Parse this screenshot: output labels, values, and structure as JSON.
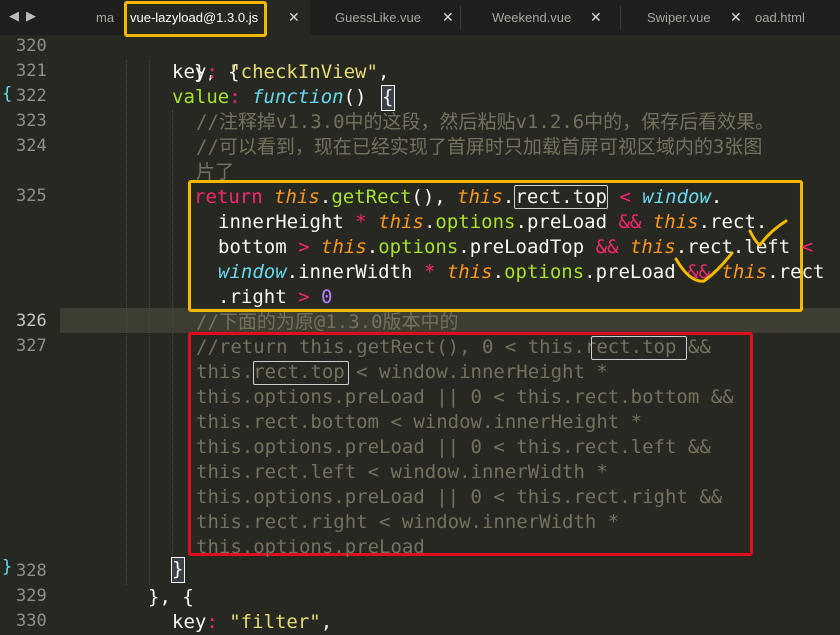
{
  "tabs": [
    {
      "label": "ma"
    },
    {
      "label": "vue-lazyload@1.3.0.js"
    },
    {
      "label": "GuessLike.vue"
    },
    {
      "label": "Weekend.vue"
    },
    {
      "label": "Swiper.vue"
    },
    {
      "label": "oad.html"
    }
  ],
  "nav": {
    "back": "◀",
    "forward": "▶"
  },
  "close_glyph": "✕",
  "line_numbers": [
    "320",
    "321",
    "322",
    "323",
    "324",
    "325",
    "326",
    "327",
    "328",
    "329",
    "330"
  ],
  "code": {
    "l320": "}, {",
    "l321_key": "key",
    "l321_colon": ": ",
    "l321_val": "\"checkInView\"",
    "l321_comma": ",",
    "l322_value": "value",
    "l322_colon": ": ",
    "l322_function": "function",
    "l322_paren": "() ",
    "l322_brace": "{",
    "l323": "//注释掉v1.3.0中的这段，然后粘贴v1.2.6中的，保存后看效果。",
    "l324a": "//可以看到，现在已经实现了首屏时只加载首屏可视区域内的3张图",
    "l324b": "片了",
    "l325": {
      "return": "return",
      "this": "this",
      "getRect": "getRect",
      "rect": "rect",
      "top": "top",
      "window": "window",
      "innerHeight": "innerHeight",
      "options": "options",
      "preLoad": "preLoad",
      "bottom": "bottom",
      "preLoadTop": "preLoadTop",
      "left": "left",
      "innerWidth": "innerWidth",
      "right": "right",
      "zero": "0"
    },
    "l326": "//下面的为原@1.3.0版本中的",
    "l327": [
      "//return this.getRect(), 0 < this.rect.top &&",
      "this.rect.top < window.innerHeight *",
      "this.options.preLoad || 0 < this.rect.bottom &&",
      "this.rect.bottom < window.innerHeight *",
      "this.options.preLoad || 0 < this.rect.left &&",
      "this.rect.left < window.innerWidth *",
      "this.options.preLoad || 0 < this.rect.right &&",
      "this.rect.right < window.innerWidth *",
      "this.options.preLoad"
    ],
    "l328": "}",
    "l329": "}, {",
    "l330_key": "key",
    "l330_colon": ": ",
    "l330_val": "\"filter\"",
    "l330_comma": ","
  },
  "colors": {
    "background": "#272822",
    "keyword": "#f92672",
    "this": "#fd971f",
    "function_name": "#a6e22e",
    "string": "#e6db74",
    "number": "#ae81ff",
    "type": "#66d9ef",
    "comment": "#75715e",
    "annotation_yellow": "#f5b800",
    "annotation_red": "#e00f1e"
  }
}
